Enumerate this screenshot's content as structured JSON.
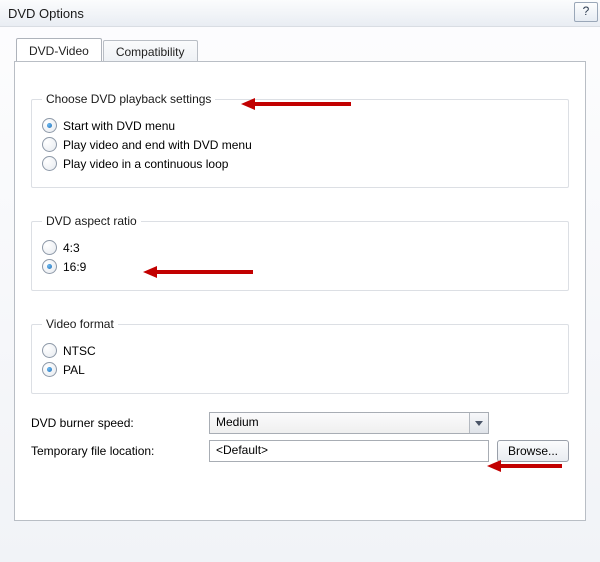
{
  "window": {
    "title": "DVD Options",
    "help_tooltip": "?"
  },
  "tabs": {
    "dvd_video": "DVD-Video",
    "compatibility": "Compatibility",
    "active": "dvd_video"
  },
  "playback": {
    "legend": "Choose DVD playback settings",
    "options": {
      "menu": "Start with DVD menu",
      "play_then_menu": "Play video and end with DVD menu",
      "loop": "Play video in a continuous loop"
    },
    "selected": "menu"
  },
  "aspect": {
    "legend": "DVD aspect ratio",
    "options": {
      "r43": "4:3",
      "r169": "16:9"
    },
    "selected": "r169"
  },
  "video_format": {
    "legend": "Video format",
    "options": {
      "ntsc": "NTSC",
      "pal": "PAL"
    },
    "selected": "pal"
  },
  "burner_speed": {
    "label": "DVD burner speed:",
    "value": "Medium"
  },
  "temp_location": {
    "label": "Temporary file location:",
    "value": "<Default>",
    "browse_label": "Browse..."
  }
}
